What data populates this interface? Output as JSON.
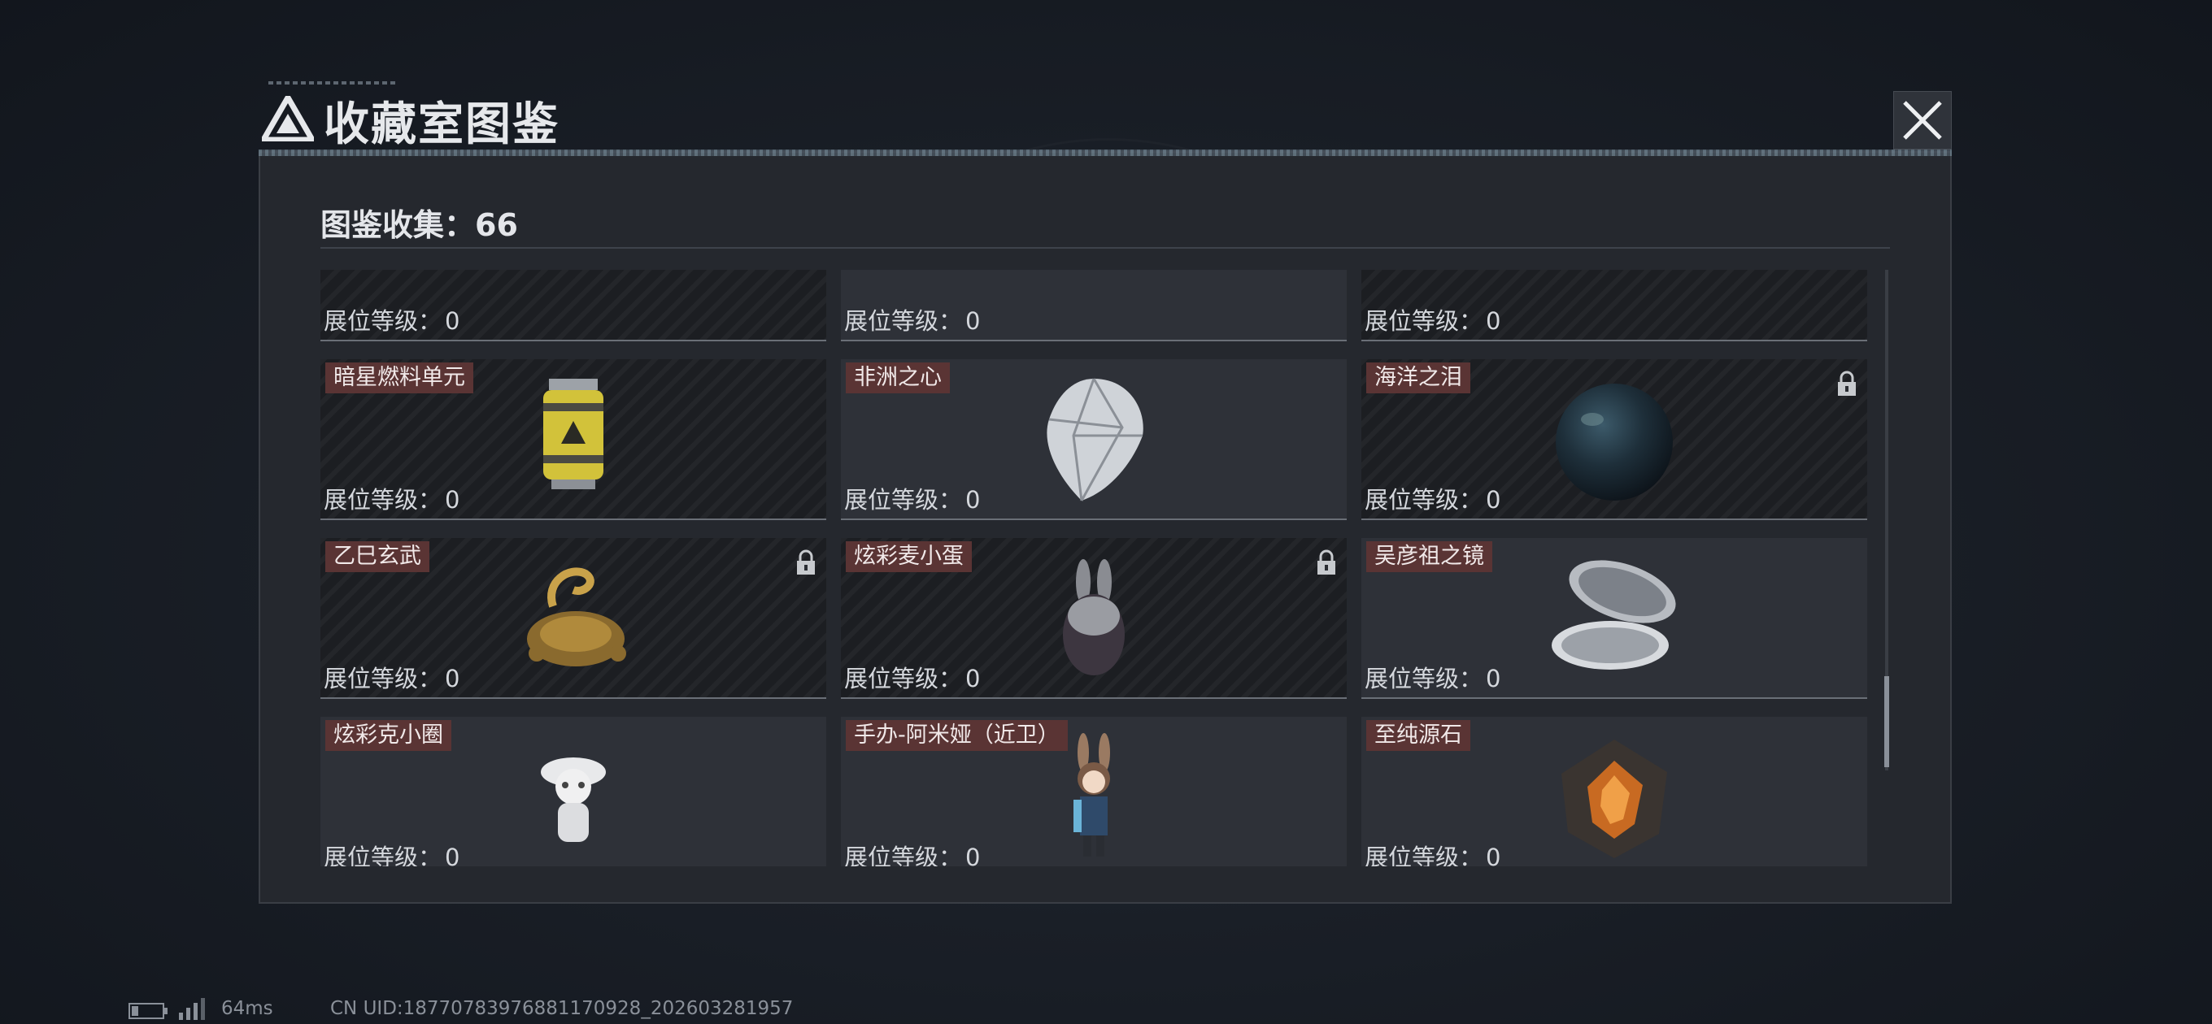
{
  "window": {
    "title": "收藏室图鉴"
  },
  "collection": {
    "label": "图鉴收集：66"
  },
  "level_label": "展位等级：",
  "cards": [
    {
      "name": "",
      "level": "0",
      "style": "dark",
      "locked": false,
      "icon": "grate-device-icon"
    },
    {
      "name": "",
      "level": "0",
      "style": "light",
      "locked": false,
      "icon": "metal-cylinder-icon"
    },
    {
      "name": "",
      "level": "0",
      "style": "dark",
      "locked": false,
      "icon": "circuit-box-icon"
    },
    {
      "name": "暗星燃料单元",
      "level": "0",
      "style": "dark",
      "locked": false,
      "icon": "fuel-canister-icon"
    },
    {
      "name": "非洲之心",
      "level": "0",
      "style": "light",
      "locked": false,
      "icon": "diamond-icon"
    },
    {
      "name": "海洋之泪",
      "level": "0",
      "style": "dark",
      "locked": true,
      "icon": "dark-pearl-icon"
    },
    {
      "name": "乙巳玄武",
      "level": "0",
      "style": "dark",
      "locked": true,
      "icon": "golden-turtle-icon"
    },
    {
      "name": "炫彩麦小蛋",
      "level": "0",
      "style": "dark",
      "locked": true,
      "icon": "bunny-egg-icon"
    },
    {
      "name": "吴彦祖之镜",
      "level": "0",
      "style": "light",
      "locked": false,
      "icon": "compact-mirror-icon"
    },
    {
      "name": "炫彩克小圈",
      "level": "0",
      "style": "light",
      "locked": false,
      "icon": "figurine-icon"
    },
    {
      "name": "手办-阿米娅（近卫）",
      "level": "0",
      "style": "light",
      "locked": false,
      "icon": "amiya-figure-icon"
    },
    {
      "name": "至纯源石",
      "level": "0",
      "style": "light",
      "locked": false,
      "icon": "originium-crystal-icon"
    }
  ],
  "status": {
    "ping": "64ms",
    "uid": "CN UID:18770783976881170928_202603281957"
  },
  "colors": {
    "name_tag_bg": "#5a3434",
    "panel_bg": "#25282e"
  }
}
